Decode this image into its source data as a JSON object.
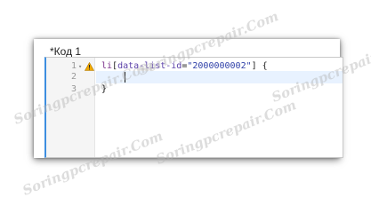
{
  "document": {
    "title": "*Код 1"
  },
  "editor": {
    "lines": [
      {
        "number": "1",
        "code_parts": [
          "li",
          "[",
          "data-list-id",
          "=",
          "\"2000000002\"",
          "] {"
        ]
      },
      {
        "number": "2",
        "code": ""
      },
      {
        "number": "3",
        "code": "}"
      }
    ],
    "warning_icon": "warning-triangle-icon",
    "fold_icon": "fold-arrow-icon"
  },
  "watermark_text": "Soringpcrepair.Com",
  "colors": {
    "accent": "#3d8ee0",
    "active_line": "#e8f2ff",
    "warning": "#f0a800"
  }
}
